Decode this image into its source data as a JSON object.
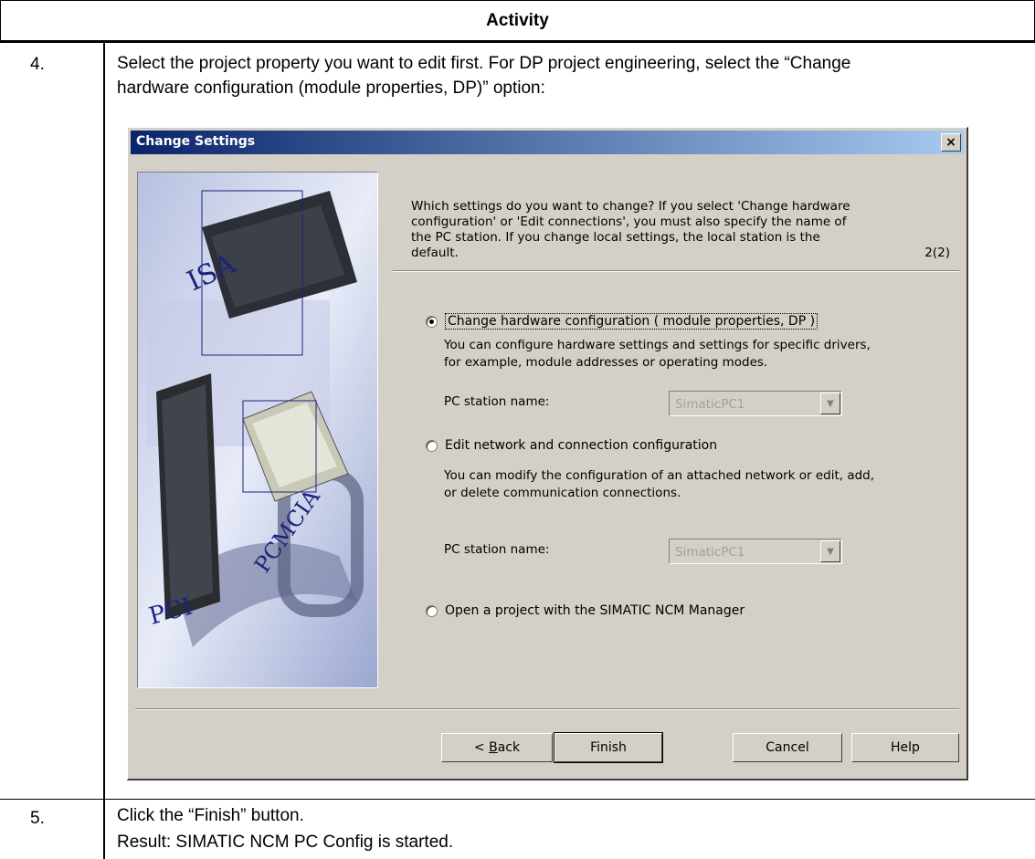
{
  "header": {
    "title": "Activity"
  },
  "steps": [
    {
      "number": "4.",
      "text_line1": "Select the project property you want to edit first. For DP project engineering, select the “Change",
      "text_line2": "hardware configuration (module properties, DP)” option:"
    },
    {
      "number": "5.",
      "text_line1": "Click the “Finish” button.",
      "text_line2": "Result: SIMATIC NCM PC Config is started."
    }
  ],
  "dialog": {
    "title": "Change Settings",
    "close_label": "×",
    "intro_line1": "Which settings do you want to change? If you select 'Change hardware",
    "intro_line2": "configuration' or 'Edit connections', you must also specify the name of",
    "intro_line3": "the PC station. If you change local settings, the local station is the",
    "intro_line4": "default.",
    "page_indicator": "2(2)",
    "options": [
      {
        "label": "Change hardware configuration ( module properties, DP )",
        "selected": true,
        "desc_line1": "You can configure hardware settings and settings for specific drivers,",
        "desc_line2": "for example, module addresses or operating modes.",
        "field_label": "PC station name:",
        "field_value": "SimaticPC1"
      },
      {
        "label": "Edit network and connection configuration",
        "selected": false,
        "desc_line1": "You can modify the configuration of an attached network or edit, add,",
        "desc_line2": "or delete communication connections.",
        "field_label": "PC station name:",
        "field_value": "SimaticPC1"
      },
      {
        "label": "Open a project with the SIMATIC NCM Manager",
        "selected": false
      }
    ],
    "image_labels": {
      "isa": "ISA",
      "pci": "PCI",
      "pcmcia": "PCMCIA"
    },
    "buttons": {
      "back_prefix": "< ",
      "back_mnemonic": "B",
      "back_rest": "ack",
      "finish": "Finish",
      "cancel": "Cancel",
      "help": "Help"
    }
  }
}
